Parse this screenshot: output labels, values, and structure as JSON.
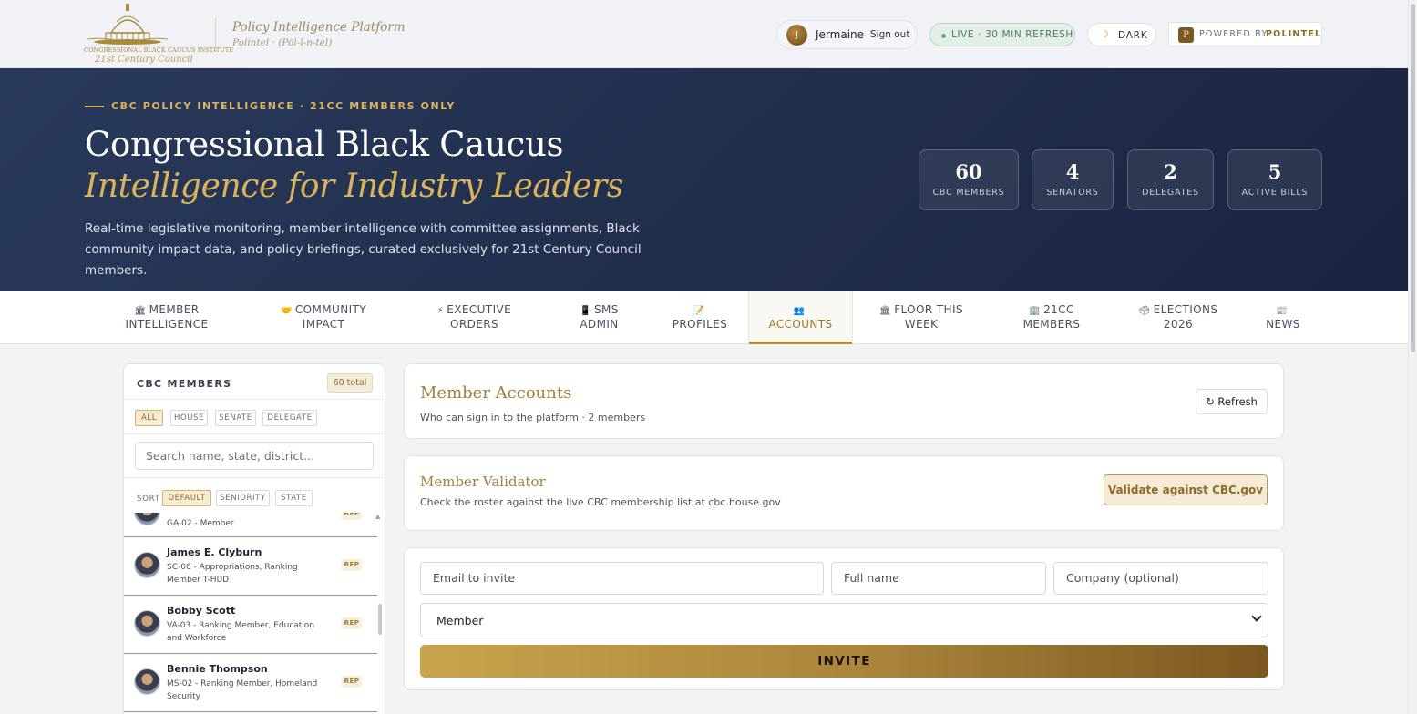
{
  "header": {
    "logo_line1": "CONGRESSIONAL BLACK CAUCUS INSTITUTE",
    "logo_line2": "21st Century Council",
    "platform_name": "Policy Intelligence Platform",
    "platform_sub": "Polintel · (Pöl-ĭ-n-tel)",
    "user_initial": "J",
    "user_name": "Jermaine",
    "signout_label": "Sign out",
    "live_label": "LIVE · 30 MIN REFRESH",
    "dark_icon": "moon-icon",
    "dark_label": "DARK",
    "powered_logo": "P",
    "powered_label": "POWERED BY",
    "powered_brand": "POLINTEL",
    "accent_color": "#b48a2e",
    "live_color": "#63a97b"
  },
  "hero": {
    "eyebrow": "CBC POLICY INTELLIGENCE · 21CC MEMBERS ONLY",
    "title": "Congressional Black Caucus",
    "subtitle": "Intelligence for Industry Leaders",
    "description": "Real-time legislative monitoring, member intelligence with committee assignments, Black community impact data, and policy briefings, curated exclusively for 21st Century Council members.",
    "background_color": "#22304e",
    "stats": [
      {
        "value": "60",
        "label": "CBC MEMBERS"
      },
      {
        "value": "4",
        "label": "SENATORS"
      },
      {
        "value": "2",
        "label": "DELEGATES"
      },
      {
        "value": "5",
        "label": "ACTIVE BILLS"
      }
    ]
  },
  "tabs": [
    {
      "icon": "🏛",
      "line1": "MEMBER",
      "line2": "INTELLIGENCE",
      "active": false
    },
    {
      "icon": "🤝",
      "line1": "COMMUNITY",
      "line2": "IMPACT",
      "active": false
    },
    {
      "icon": "⚡",
      "line1": "EXECUTIVE",
      "line2": "ORDERS",
      "active": false
    },
    {
      "icon": "📱",
      "line1": "SMS",
      "line2": "ADMIN",
      "active": false
    },
    {
      "icon": "📝",
      "line1": "",
      "line2": "PROFILES",
      "active": false
    },
    {
      "icon": "👥",
      "line1": "",
      "line2": "ACCOUNTS",
      "active": true
    },
    {
      "icon": "🏛",
      "line1": "FLOOR THIS",
      "line2": "WEEK",
      "active": false
    },
    {
      "icon": "🏢",
      "line1": "21CC",
      "line2": "MEMBERS",
      "active": false
    },
    {
      "icon": "🗳",
      "line1": "ELECTIONS",
      "line2": "2026",
      "active": false
    },
    {
      "icon": "📰",
      "line1": "",
      "line2": "NEWS",
      "active": false
    }
  ],
  "sidebar": {
    "title": "CBC MEMBERS",
    "total": "60 total",
    "filters": [
      "ALL",
      "HOUSE",
      "SENATE",
      "DELEGATE"
    ],
    "active_filter": "ALL",
    "search_placeholder": "Search name, state, district...",
    "sort_label": "SORT",
    "sorts": [
      "DEFAULT",
      "SENIORITY",
      "STATE"
    ],
    "active_sort": "DEFAULT",
    "members": [
      {
        "name": "",
        "meta": "GA-02 - Member",
        "badge": "REP"
      },
      {
        "name": "James E. Clyburn",
        "meta": "SC-06 - Appropriations, Ranking Member T-HUD",
        "badge": "REP"
      },
      {
        "name": "Bobby Scott",
        "meta": "VA-03 - Ranking Member, Education and Workforce",
        "badge": "REP"
      },
      {
        "name": "Bennie Thompson",
        "meta": "MS-02 - Ranking Member, Homeland Security",
        "badge": "REP"
      }
    ]
  },
  "accounts": {
    "title": "Member Accounts",
    "subtitle": "Who can sign in to the platform · 2 members",
    "refresh_label": "↻ Refresh"
  },
  "validator": {
    "title": "Member Validator",
    "subtitle": "Check the roster against the live CBC membership list at cbc.house.gov",
    "button_label": "Validate against CBC.gov"
  },
  "invite": {
    "email_placeholder": "Email to invite",
    "name_placeholder": "Full name",
    "company_placeholder": "Company (optional)",
    "role_value": "Member",
    "button_label": "INVITE"
  }
}
